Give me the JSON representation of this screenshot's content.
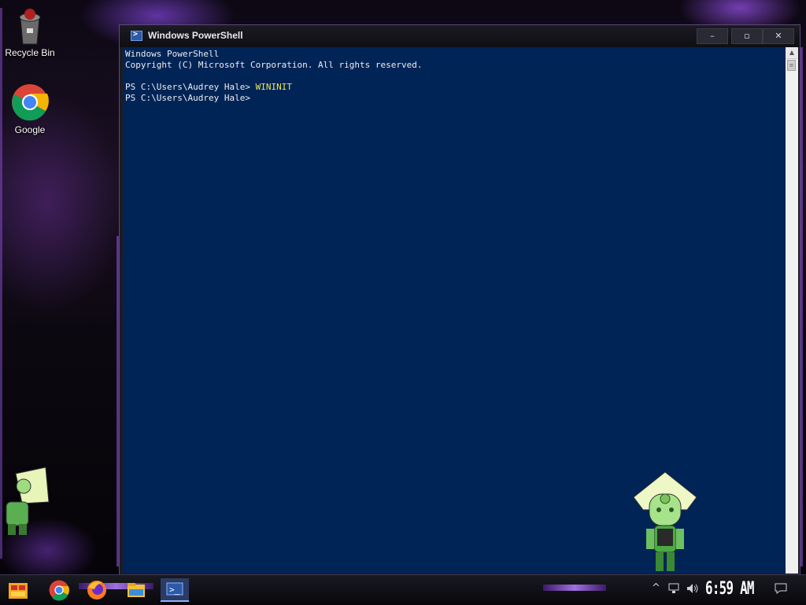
{
  "desktop": {
    "icons": [
      {
        "label": "Recycle Bin",
        "icon": "recycle-bin-icon"
      },
      {
        "label": "Google",
        "icon": "chrome-icon"
      }
    ]
  },
  "window": {
    "title": "Windows PowerShell",
    "icon": "powershell-icon",
    "buttons": {
      "minimize": "–",
      "maximize": "▫",
      "close": "✕"
    }
  },
  "console": {
    "lines": [
      "Windows PowerShell",
      "Copyright (C) Microsoft Corporation. All rights reserved.",
      "",
      "PS C:\\Users\\Audrey Hale> ",
      "PS C:\\Users\\Audrey Hale>"
    ],
    "command": "WININIT",
    "colors": {
      "background": "#012456",
      "text": "#eeedf0",
      "command": "#e6e65a"
    }
  },
  "taskbar": {
    "items": [
      "start-icon",
      "chrome-icon",
      "firefox-icon",
      "file-explorer-icon",
      "powershell-icon"
    ],
    "tray": {
      "chevron": "^",
      "network": "network-icon",
      "volume": "volume-icon",
      "notification": "notification-icon"
    },
    "clock": "6:59 AM"
  }
}
